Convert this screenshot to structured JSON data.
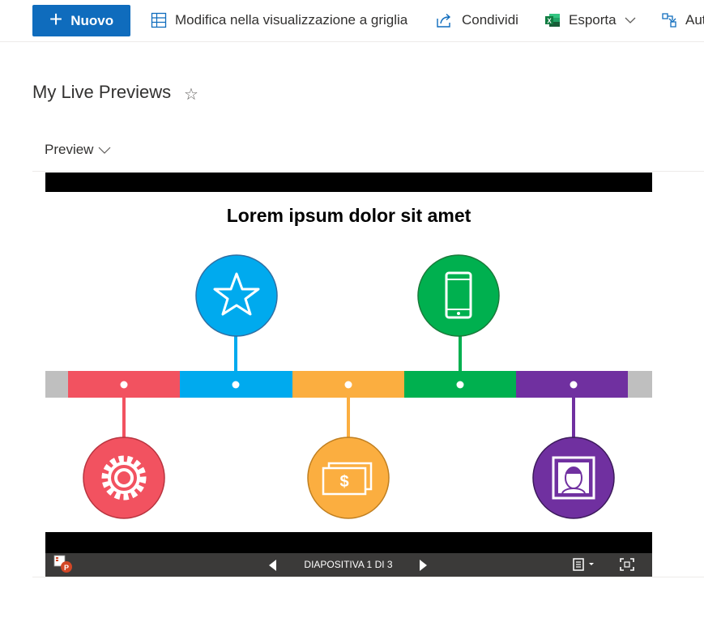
{
  "commandbar": {
    "new_label": "Nuovo",
    "grid_label": "Modifica nella visualizzazione a griglia",
    "share_label": "Condividi",
    "export_label": "Esporta",
    "automate_label": "Aut"
  },
  "list": {
    "title": "My Live Previews",
    "column_header": "Preview"
  },
  "slide": {
    "title": "Lorem ipsum dolor sit amet",
    "colors": {
      "red": "#f25260",
      "blue": "#00aaee",
      "orange": "#fbae40",
      "green": "#00b04f",
      "purple": "#7030a0",
      "gray": "#bfbfbf"
    }
  },
  "viewer": {
    "slide_counter": "DIAPOSITIVA 1 DI 3"
  },
  "icons": {
    "new": "plus-icon",
    "grid": "grid-icon",
    "share": "share-icon",
    "export": "excel-icon",
    "automate": "automate-icon",
    "favorite": "star-outline-icon",
    "sort": "chevron-down-icon"
  }
}
